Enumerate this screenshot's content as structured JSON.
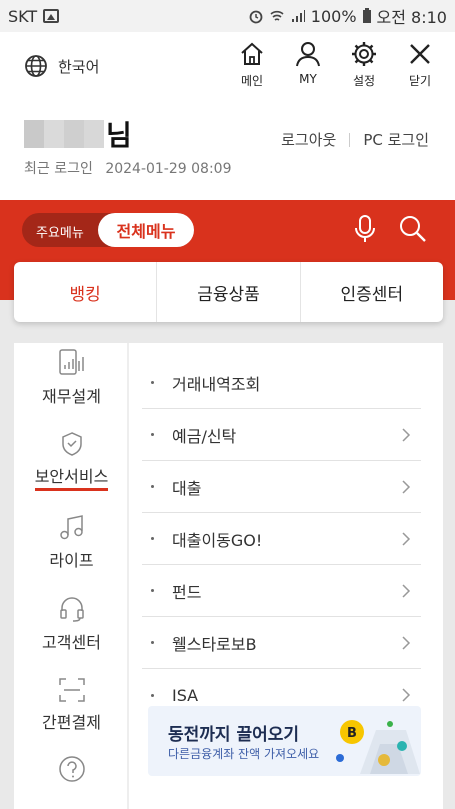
{
  "status": {
    "carrier": "SKT",
    "battery": "100%",
    "time": "오전 8:10"
  },
  "header": {
    "language": "한국어",
    "icons": [
      {
        "label": "메인",
        "icon": "home-icon"
      },
      {
        "label": "MY",
        "icon": "person-icon"
      },
      {
        "label": "설정",
        "icon": "gear-icon"
      },
      {
        "label": "닫기",
        "icon": "close-icon"
      }
    ],
    "name_suffix": "님",
    "last_login_label": "최근 로그인",
    "last_login_value": "2024-01-29 08:09",
    "logout": "로그아웃",
    "pc_login": "PC 로그인"
  },
  "menu_toggle": {
    "main_menu": "주요메뉴",
    "all_menu": "전체메뉴"
  },
  "tabs": [
    {
      "label": "뱅킹",
      "active": true
    },
    {
      "label": "금융상품",
      "active": false
    },
    {
      "label": "인증센터",
      "active": false
    }
  ],
  "sidebar": {
    "items": [
      {
        "label": "재무설계",
        "icon": "finance-chart-icon"
      },
      {
        "label": "보안서비스",
        "icon": "shield-icon",
        "active": true
      },
      {
        "label": "라이프",
        "icon": "music-note-icon"
      },
      {
        "label": "고객센터",
        "icon": "headset-icon"
      },
      {
        "label": "간편결제",
        "icon": "scan-frame-icon"
      },
      {
        "label": "",
        "icon": "help-icon"
      }
    ]
  },
  "sublist": {
    "items": [
      {
        "label": "거래내역조회",
        "chevron": false
      },
      {
        "label": "예금/신탁",
        "chevron": true
      },
      {
        "label": "대출",
        "chevron": true
      },
      {
        "label": "대출이동GO!",
        "chevron": true
      },
      {
        "label": "펀드",
        "chevron": true
      },
      {
        "label": "웰스타로보B",
        "chevron": true
      },
      {
        "label": "ISA",
        "chevron": true
      }
    ]
  },
  "banner": {
    "title": "동전까지 끌어오기",
    "subtitle": "다른금융계좌 잔액 가져오세요"
  },
  "colors": {
    "accent": "#d9321d",
    "toggle_bg": "#a42718",
    "banner_bg": "#eef3fb"
  }
}
